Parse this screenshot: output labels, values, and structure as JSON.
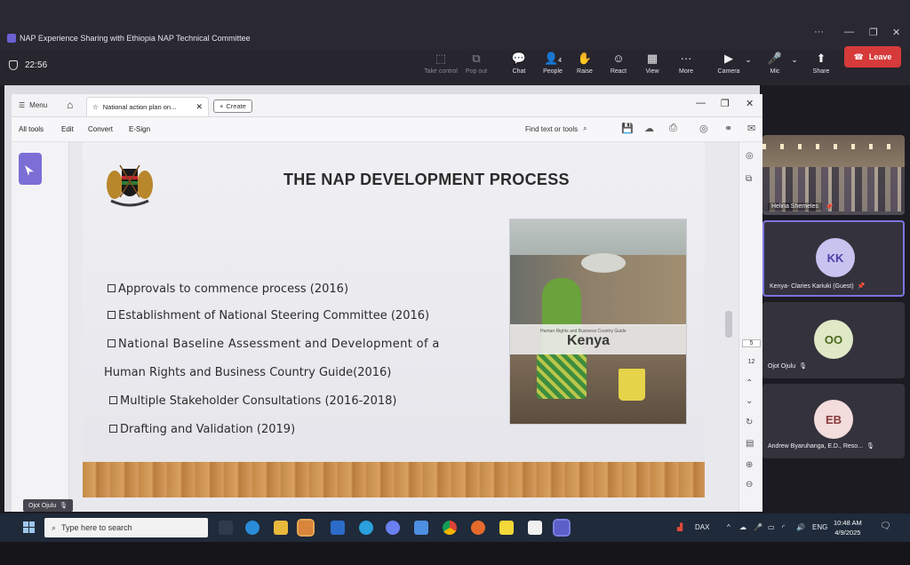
{
  "teams": {
    "meeting_title": "NAP Experience Sharing with Ethiopia NAP Technical Committee",
    "timer": "22:56",
    "toolbar": {
      "take_control": "Take control",
      "pop_out": "Pop out",
      "chat": "Chat",
      "people": "People",
      "people_count": "4",
      "raise": "Raise",
      "react": "React",
      "view": "View",
      "more": "More",
      "camera": "Camera",
      "mic": "Mic",
      "share": "Share",
      "leave": "Leave"
    }
  },
  "acrobat": {
    "menu": "Menu",
    "tab_title": "National action plan on...",
    "create": "Create",
    "menu_items": [
      "All tools",
      "Edit",
      "Convert",
      "E-Sign"
    ],
    "find": "Find text or tools",
    "page_current": "5",
    "page_total": "12"
  },
  "slide": {
    "title": "THE NAP DEVELOPMENT PROCESS",
    "bullets": [
      "Approvals to commence process (2016)",
      "Establishment of National Steering Committee (2016)",
      "National Baseline Assessment and Development of a",
      "Human Rights and Business Country Guide(2016)",
      "Multiple Stakeholder Consultations (2016-2018)",
      "Drafting and Validation (2019)"
    ],
    "cover_small": "Human Rights and Business Country Guide",
    "cover_title": "Kenya"
  },
  "presenter_label": "Ojot Ojulu",
  "participants": [
    {
      "name": "Helina Shemeles"
    },
    {
      "name": "Kenya- Claries Kariuki (Guest)",
      "initials": "KK",
      "color": "#c9c3f0",
      "text": "#4b3fa8"
    },
    {
      "name": "Ojot Ojulu",
      "initials": "OO",
      "color": "#dfe8c7",
      "text": "#4a6a1c"
    },
    {
      "name": "Andrew Byaruhanga, E.D., Reso...",
      "initials": "EB",
      "color": "#f2dcdc",
      "text": "#8a3a3a"
    }
  ],
  "taskbar": {
    "search_placeholder": "Type here to search",
    "dax": "DAX",
    "lang": "ENG",
    "time": "10:48 AM",
    "date": "4/9/2025"
  }
}
